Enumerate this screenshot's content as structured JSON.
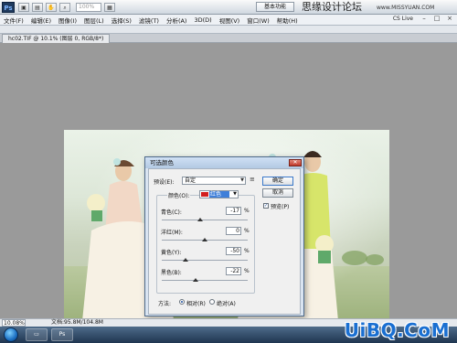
{
  "app": {
    "logo": "Ps",
    "zoom_combo": "100%",
    "workspace_button": "基本功能",
    "site_name": "思缘设计论坛",
    "site_url": "www.MISSYUAN.COM",
    "cs_live": "CS Live"
  },
  "menu": {
    "items": [
      "文件(F)",
      "编辑(E)",
      "图像(I)",
      "图层(L)",
      "选择(S)",
      "滤镜(T)",
      "分析(A)",
      "3D(D)",
      "视图(V)",
      "窗口(W)",
      "帮助(H)"
    ]
  },
  "window_buttons": {
    "minimize": "–",
    "maximize": "□",
    "close": "×"
  },
  "document": {
    "tab_label": "hc02.TIF @ 10.1% (图层 0, RGB/8*)"
  },
  "dialog": {
    "title": "可选颜色",
    "close_icon": "close-icon",
    "preset_label": "预设(E):",
    "preset_value": "自定",
    "colors_label": "颜色(O):",
    "colors_value": "红色",
    "colors_swatch": "#d11e1e",
    "sliders": [
      {
        "label": "青色(C):",
        "value": "-17",
        "unit": "%"
      },
      {
        "label": "洋红(M):",
        "value": "0",
        "unit": "%"
      },
      {
        "label": "黄色(Y):",
        "value": "-50",
        "unit": "%"
      },
      {
        "label": "黑色(B):",
        "value": "-22",
        "unit": "%"
      }
    ],
    "ok_label": "确定",
    "cancel_label": "取消",
    "preview_label": "预览(P)",
    "preview_checked": true,
    "method_label": "方法:",
    "method_relative": "相对(R)",
    "method_absolute": "绝对(A)",
    "method_selected": "relative"
  },
  "status": {
    "zoom": "10.08%",
    "doc": "文档:95.8M/104.8M"
  },
  "watermark": "UiBQ.CoM",
  "colors": {
    "accent": "#3f7fd9",
    "watermark": "#1a6fd1"
  }
}
